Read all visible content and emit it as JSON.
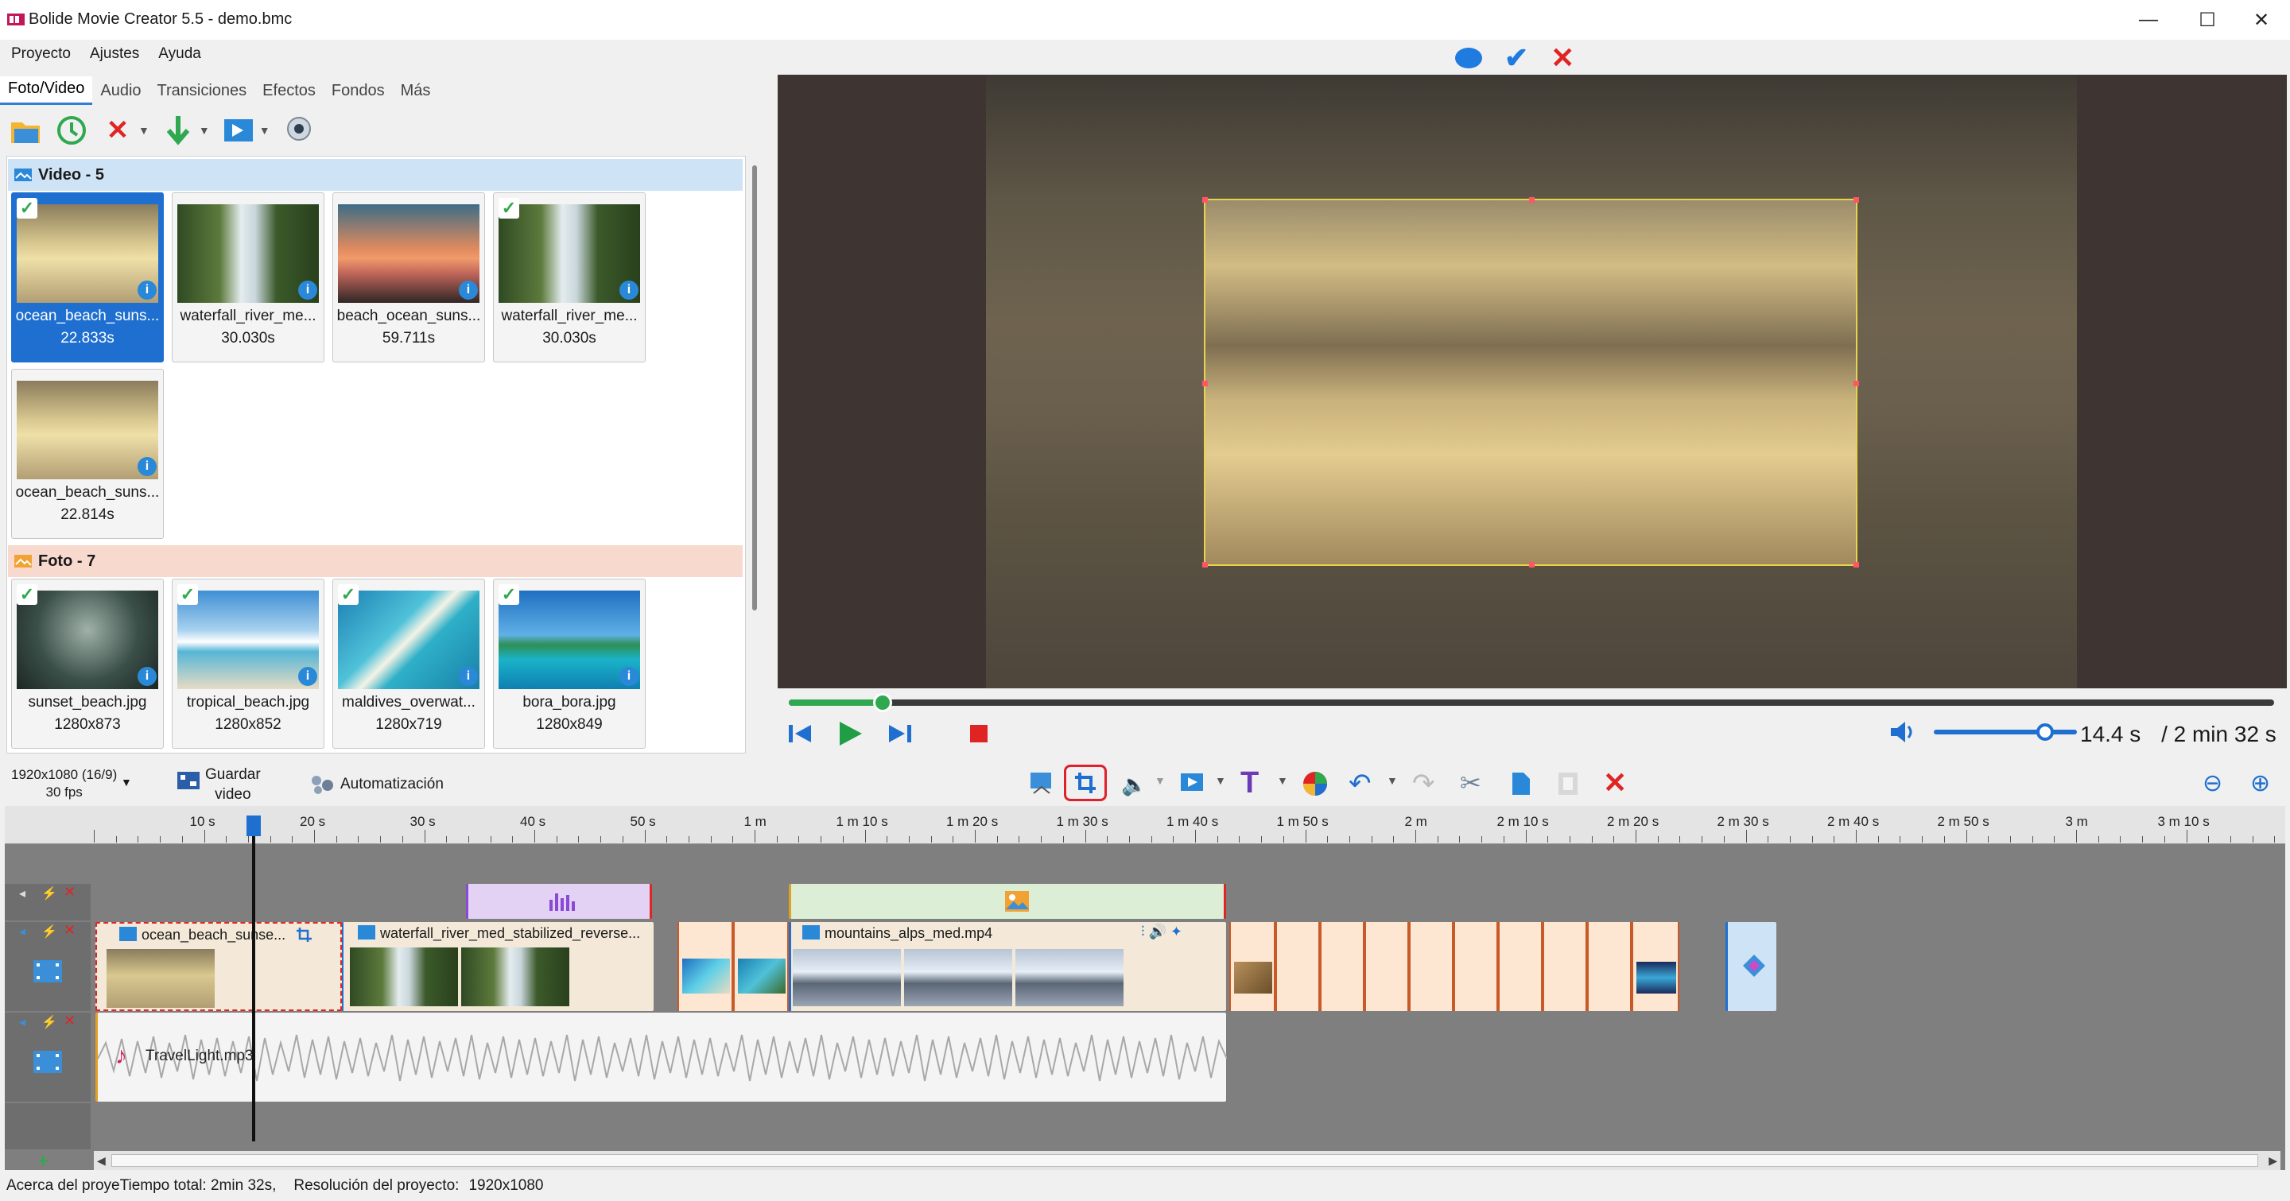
{
  "window": {
    "title": "Bolide Movie Creator 5.5 - demo.bmc"
  },
  "menu": [
    "Proyecto",
    "Ajustes",
    "Ayuda"
  ],
  "tabs": [
    "Foto/Video",
    "Audio",
    "Transiciones",
    "Efectos",
    "Fondos",
    "Más"
  ],
  "library": {
    "video_group": "Video - 5",
    "videos": [
      {
        "name": "ocean_beach_suns...",
        "duration": "22.833s",
        "selected": true,
        "checked": true
      },
      {
        "name": "waterfall_river_me...",
        "duration": "30.030s",
        "selected": false,
        "checked": false
      },
      {
        "name": "beach_ocean_suns...",
        "duration": "59.711s",
        "selected": false,
        "checked": false
      },
      {
        "name": "waterfall_river_me...",
        "duration": "30.030s",
        "selected": false,
        "checked": true
      },
      {
        "name": "ocean_beach_suns...",
        "duration": "22.814s",
        "selected": false,
        "checked": false
      }
    ],
    "photo_group": "Foto - 7",
    "photos": [
      {
        "name": "sunset_beach.jpg",
        "size": "1280x873",
        "checked": true
      },
      {
        "name": "tropical_beach.jpg",
        "size": "1280x852",
        "checked": true
      },
      {
        "name": "maldives_overwat...",
        "size": "1280x719",
        "checked": true
      },
      {
        "name": "bora_bora.jpg",
        "size": "1280x849",
        "checked": true
      }
    ]
  },
  "playback": {
    "current": "14.4 s",
    "total": "/ 2 min 32 s",
    "progress": 0.063,
    "volume": 0.78
  },
  "project": {
    "resolution_label": "1920x1080 (16/9)",
    "fps": "30 fps",
    "save_label": "Guardar",
    "save_label2": "video",
    "auto_label": "Automatización"
  },
  "ruler_ticks": [
    "10 s",
    "20 s",
    "30 s",
    "40 s",
    "50 s",
    "1 m",
    "1 m 10 s",
    "1 m 20 s",
    "1 m 30 s",
    "1 m 40 s",
    "1 m 50 s",
    "2 m",
    "2 m 10 s",
    "2 m 20 s",
    "2 m 30 s",
    "2 m 40 s",
    "2 m 50 s",
    "3 m",
    "3 m 10 s"
  ],
  "clips": {
    "c1": "ocean_beach_sunse...",
    "c2": "waterfall_river_med_stabilized_reverse...",
    "c3": "mountains_alps_med.mp4",
    "audio": "TravelLight.mp3"
  },
  "status": {
    "about": "Acerca del proye",
    "total": "Tiempo total: 2min 32s,",
    "res_label": "Resolución del proyecto:",
    "res": "1920x1080"
  },
  "colors": {
    "accent": "#1f6fd1",
    "video_group_bg": "#cfe3f7",
    "photo_group_bg": "#f8d9cd"
  }
}
